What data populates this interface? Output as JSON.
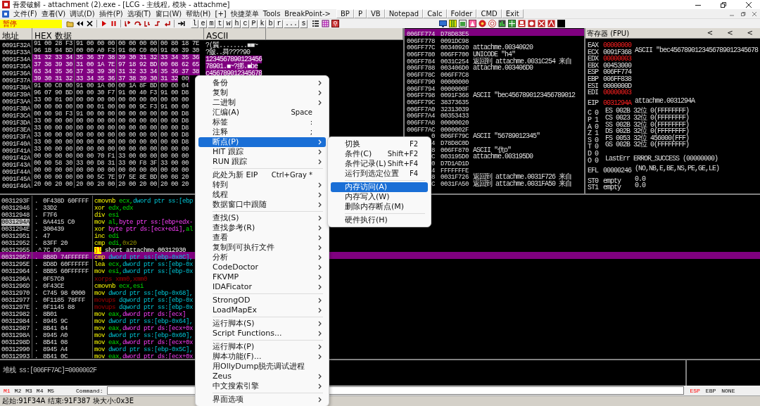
{
  "window": {
    "title": "吾爱破解 - attachment (2).exe - [LCG - 主线程, 模块 - attachme]"
  },
  "menu_bar": {
    "items": [
      "文件(F)",
      "查看(V)",
      "调试(D)",
      "插件(P)",
      "选项(T)",
      "窗口(W)",
      "帮助(H)",
      "[+]",
      "快捷菜单",
      "Tools",
      "BreakPoint->"
    ],
    "buttons": [
      "BP",
      "P",
      "VB",
      "Notepad",
      "Calc",
      "Folder",
      "CMD",
      "Exit"
    ]
  },
  "toolbar": {
    "status": "暂停",
    "letter_buttons": [
      "l",
      "e",
      "m",
      "t",
      "w",
      "h",
      "c",
      "P",
      "k",
      "b",
      "r",
      "...",
      "s"
    ]
  },
  "hex_dump": {
    "columns": [
      "地址",
      "HEX 数据",
      "ASCII"
    ],
    "rows": [
      {
        "address": "0091F32A",
        "groups": [
          {
            "bytes": "91 00 28 F3",
            "selected": false
          },
          {
            "bytes": "91 00 00 00",
            "selected": false
          },
          {
            "bytes": "00 00 00 00",
            "selected": false
          },
          {
            "bytes": "00 80 18 7E",
            "selected": false
          }
        ],
        "ascii": "?(鬤........■■~",
        "ascii_selected": false
      },
      {
        "address": "0091F33A",
        "groups": [
          {
            "bytes": "96 1B 94 BD",
            "selected": false
          },
          {
            "bytes": "00 00 A0 F3",
            "selected": false
          },
          {
            "bytes": "91 00 C0 00",
            "selected": false
          },
          {
            "bytes": "91 00 39 30",
            "selected": false
          }
        ],
        "ascii": "?皼..曻????90",
        "ascii_selected": false
      },
      {
        "address": "0091F34A",
        "groups": [
          {
            "bytes": "31 32 33 34",
            "selected": true
          },
          {
            "bytes": "35 36 37 38",
            "selected": true
          },
          {
            "bytes": "39 30 31 32",
            "selected": true
          },
          {
            "bytes": "33 34 35 36",
            "selected": true
          }
        ],
        "ascii": "1234567890123456",
        "ascii_selected": true
      },
      {
        "address": "0091F35A",
        "groups": [
          {
            "bytes": "37 38 39 30",
            "selected": true
          },
          {
            "bytes": "31 00 1A 7E",
            "selected": true
          },
          {
            "bytes": "97 18 92 BD",
            "selected": true
          },
          {
            "bytes": "00 08 62 65",
            "selected": true
          }
        ],
        "ascii": "78901.■~?挷.■be",
        "ascii_selected": true
      },
      {
        "address": "0091F36A",
        "groups": [
          {
            "bytes": "63 34 35 36",
            "selected": true
          },
          {
            "bytes": "37 38 39 30",
            "selected": true
          },
          {
            "bytes": "31 32 33 34",
            "selected": true
          },
          {
            "bytes": "35 36 37 38",
            "selected": true
          }
        ],
        "ascii": "c456789012345678",
        "ascii_selected": true
      },
      {
        "address": "0091F37A",
        "groups": [
          {
            "bytes": "39 30 31 32",
            "selected": true
          },
          {
            "bytes": "33 34 35 36",
            "selected": true
          },
          {
            "bytes": "37 38 39 30",
            "selected": true
          },
          {
            "bytes": "31 32",
            "selected": true,
            "tail": "00"
          }
        ]
      },
      {
        "address": "0091F38A",
        "groups": [
          {
            "bytes": "91 00 C0 00",
            "selected": false
          },
          {
            "bytes": "91 00 1A 00",
            "selected": false
          },
          {
            "bytes": "00 1A 8F BD",
            "selected": false
          },
          {
            "bytes": "00 00 04",
            "selected": false
          }
        ]
      },
      {
        "address": "0091F39A",
        "groups": [
          {
            "bytes": "96 07 90 BD",
            "selected": false
          },
          {
            "bytes": "00 00 30 F7",
            "selected": false
          },
          {
            "bytes": "91 00 40 F3",
            "selected": false
          },
          {
            "bytes": "91 00 D8",
            "selected": false
          }
        ]
      },
      {
        "address": "0091F3AA",
        "groups": [
          {
            "bytes": "33 00 01 00",
            "selected": false
          },
          {
            "bytes": "00 00 00 00",
            "selected": false
          },
          {
            "bytes": "00 00 00 00",
            "selected": false
          },
          {
            "bytes": "00 00 00",
            "selected": false
          }
        ]
      },
      {
        "address": "0091F3BA",
        "groups": [
          {
            "bytes": "00 00 00 00",
            "selected": false
          },
          {
            "bytes": "00 00 01 00",
            "selected": false
          },
          {
            "bytes": "00 00 9C F3",
            "selected": false
          },
          {
            "bytes": "91 00 00",
            "selected": false
          }
        ]
      },
      {
        "address": "0091F3CA",
        "groups": [
          {
            "bytes": "00 00 98 F3",
            "selected": false
          },
          {
            "bytes": "91 00 00 00",
            "selected": false
          },
          {
            "bytes": "00 00 00 00",
            "selected": false
          },
          {
            "bytes": "00 00 D8",
            "selected": false
          }
        ]
      },
      {
        "address": "0091F3DA",
        "groups": [
          {
            "bytes": "33 00 00 00",
            "selected": false
          },
          {
            "bytes": "00 00 00 00",
            "selected": false
          },
          {
            "bytes": "00 00 00 00",
            "selected": false
          },
          {
            "bytes": "00 00 D8",
            "selected": false
          }
        ]
      },
      {
        "address": "0091F3EA",
        "groups": [
          {
            "bytes": "33 00 00 00",
            "selected": false
          },
          {
            "bytes": "00 00 00 00",
            "selected": false
          },
          {
            "bytes": "00 00 00 00",
            "selected": false
          },
          {
            "bytes": "00 00 D8",
            "selected": false
          }
        ]
      },
      {
        "address": "0091F3FA",
        "groups": [
          {
            "bytes": "33 00 00 00",
            "selected": false
          },
          {
            "bytes": "00 00 00 00",
            "selected": false
          },
          {
            "bytes": "00 00 00 00",
            "selected": false
          },
          {
            "bytes": "00 00 D8",
            "selected": false
          }
        ]
      },
      {
        "address": "0091F40A",
        "groups": [
          {
            "bytes": "33 00 00 00",
            "selected": false
          },
          {
            "bytes": "00 00 00 00",
            "selected": false
          },
          {
            "bytes": "00 00 00 00",
            "selected": false
          },
          {
            "bytes": "00 00 D8",
            "selected": false
          }
        ]
      },
      {
        "address": "0091F41A",
        "groups": [
          {
            "bytes": "33 00 00 00",
            "selected": false
          },
          {
            "bytes": "00 00 00 00",
            "selected": false
          },
          {
            "bytes": "00 00 00 00",
            "selected": false
          },
          {
            "bytes": "00 00 00",
            "selected": false
          }
        ]
      },
      {
        "address": "0091F42A",
        "groups": [
          {
            "bytes": "00 00 00 00",
            "selected": false
          },
          {
            "bytes": "00 00 70 F1",
            "selected": false
          },
          {
            "bytes": "33 00 00 00",
            "selected": false
          },
          {
            "bytes": "00 00 00",
            "selected": false
          }
        ]
      },
      {
        "address": "0091F43A",
        "groups": [
          {
            "bytes": "00 00 58 30",
            "selected": false
          },
          {
            "bytes": "33 00 D8 31",
            "selected": false
          },
          {
            "bytes": "33 00 F8 3F",
            "selected": false
          },
          {
            "bytes": "33 00 00",
            "selected": false
          }
        ]
      },
      {
        "address": "0091F44A",
        "groups": [
          {
            "bytes": "00 00 00 00",
            "selected": false
          },
          {
            "bytes": "00 00 00 00",
            "selected": false
          },
          {
            "bytes": "00 00 00 00",
            "selected": false
          },
          {
            "bytes": "00 00 00",
            "selected": false
          }
        ]
      },
      {
        "address": "0091F45A",
        "groups": [
          {
            "bytes": "00 00 00 00",
            "selected": false
          },
          {
            "bytes": "00 00 5C 7E",
            "selected": false
          },
          {
            "bytes": "97 5E 8E BD",
            "selected": false
          },
          {
            "bytes": "00 08 20",
            "selected": false
          }
        ]
      },
      {
        "address": "0091F46A",
        "groups": [
          {
            "bytes": "20 00 20 00",
            "selected": false
          },
          {
            "bytes": "20 00 20 00",
            "selected": false
          },
          {
            "bytes": "20 00 20 00",
            "selected": false
          },
          {
            "bytes": "20 00 20",
            "selected": false
          }
        ]
      }
    ]
  },
  "stack": {
    "rows": [
      {
        "address": "006FF774",
        "value": "D78D83E5",
        "selected": true
      },
      {
        "address": "006FF778",
        "value": "0091DC98",
        "selected": false
      },
      {
        "address": "006FF77C",
        "value": "00340920",
        "comment": "attachme.00340920",
        "selected": false
      },
      {
        "address": "006FF780",
        "value": "006FF700",
        "comment": "UNICODE \"h4\"",
        "selected": false
      },
      {
        "address": "006FF784",
        "value": "0031C254",
        "comment": "返回到 attachme.0031C254 来自",
        "selected": false
      },
      {
        "address": "006FF788",
        "value": "003406D0",
        "comment": "attachme.003406D0",
        "selected": false
      },
      {
        "address": "006FF78C",
        "value": "006FF7C8",
        "selected": false
      },
      {
        "address": "006FF790",
        "value": "00000000",
        "selected": false
      },
      {
        "address": "006FF794",
        "value": "0000000F",
        "selected": false
      },
      {
        "address": "006FF798",
        "value": "0091F368",
        "comment": "ASCII \"bec4567890123456789012",
        "selected": false
      },
      {
        "address": "006FF79C",
        "value": "38373635",
        "selected": false
      },
      {
        "address": "006FF7A0",
        "value": "32313039",
        "selected": false
      },
      {
        "address": "006FF7A4",
        "value": "00353433",
        "selected": false
      },
      {
        "address": "006FF7A8",
        "value": "00000020",
        "selected": false
      },
      {
        "address": "006FF7AC",
        "value": "0000002F",
        "selected": false
      },
      {
        "address": "0",
        "value": "006FF79C",
        "comment": "ASCII \"56789012345\"",
        "selected": false
      },
      {
        "address": "4",
        "value": "D78D8C0D",
        "selected": false
      },
      {
        "address": "8",
        "value": "006FF870",
        "comment": "ASCII \"伉o\"",
        "selected": false
      },
      {
        "address": "C",
        "value": "003195D0",
        "comment": "attachme.003195D0",
        "selected": false
      },
      {
        "address": "0",
        "value": "D7D1AD1D",
        "selected": false
      },
      {
        "address": "4",
        "value": "FFFFFFFE",
        "selected": false
      },
      {
        "address": "8",
        "value": "0031F726",
        "comment": "返回到 attachme.0031F726 来自",
        "selected": false
      },
      {
        "address": "C",
        "value": "0031FA50",
        "comment": "返回到 attachme.0031FA50 来自",
        "selected": false
      }
    ]
  },
  "registers": {
    "title": "寄存器 (FPU)",
    "buttons": [
      "<",
      "<",
      "<"
    ],
    "lines": [
      {
        "kind": "reg",
        "name": "EAX",
        "value": "00000000",
        "changed": true
      },
      {
        "kind": "reg",
        "name": "ECX",
        "value": "0091F368",
        "changed": false,
        "comment": "ASCII \"bec4567890123456789012345678"
      },
      {
        "kind": "reg",
        "name": "EDX",
        "value": "00000003",
        "changed": true
      },
      {
        "kind": "reg",
        "name": "EBX",
        "value": "00453000",
        "changed": false
      },
      {
        "kind": "reg",
        "name": "ESP",
        "value": "006FF774",
        "changed": false
      },
      {
        "kind": "reg",
        "name": "EBP",
        "value": "006FF838",
        "changed": false
      },
      {
        "kind": "reg",
        "name": "ESI",
        "value": "0000000D",
        "changed": false
      },
      {
        "kind": "reg",
        "name": "EDI",
        "value": "00000003",
        "changed": true
      },
      {
        "kind": "gap"
      },
      {
        "kind": "reg",
        "name": "EIP",
        "value": "0031294A",
        "changed": true,
        "comment": "attachme.0031294A"
      },
      {
        "kind": "gap"
      },
      {
        "kind": "flag",
        "flag": "C",
        "bit": "0",
        "detail": "ES 002B 32位 0(FFFFFFFF)"
      },
      {
        "kind": "flag",
        "flag": "P",
        "bit": "1",
        "detail": "CS 0023 32位 0(FFFFFFFF)"
      },
      {
        "kind": "flag",
        "flag": "A",
        "bit": "0",
        "detail": "SS 002B 32位 0(FFFFFFFF)"
      },
      {
        "kind": "flag",
        "flag": "Z",
        "bit": "1",
        "detail": "DS 002B 32位 0(FFFFFFFF)"
      },
      {
        "kind": "flag",
        "flag": "S",
        "bit": "0",
        "detail": "FS 0053 32位 456000(FFF)"
      },
      {
        "kind": "flag",
        "flag": "T",
        "bit": "0",
        "detail": "GS 002B 32位 0(FFFFFFFF)"
      },
      {
        "kind": "flag",
        "flag": "D",
        "bit": "0"
      },
      {
        "kind": "flag",
        "flag": "O",
        "bit": "0",
        "detail": "LastErr ERROR_SUCCESS (00000000)"
      },
      {
        "kind": "gap"
      },
      {
        "kind": "reg",
        "name": "EFL",
        "value": "00000246",
        "changed": false,
        "comment": "(NO,NB,E,BE,NS,PE,GE,LE)"
      },
      {
        "kind": "gap"
      },
      {
        "kind": "reg",
        "name": "ST0",
        "value": "empty",
        "changed": false,
        "comment": "0.0"
      },
      {
        "kind": "reg",
        "name": "ST1",
        "value": "empty",
        "changed": false,
        "comment": "0.0"
      }
    ]
  },
  "disassembly": {
    "rows": [
      {
        "address": "0031293F",
        "marker": ".",
        "hex": "0F438D 60FFFF",
        "mnemonic": {
          "text": "cmovnb",
          "kind": "op"
        },
        "operands": [
          {
            "text": "ecx,",
            "kind": "reg"
          },
          {
            "text": "dword ptr ss:[ebp",
            "kind": "stack"
          }
        ],
        "selected": false,
        "current": false
      },
      {
        "address": "00312946",
        "marker": ".",
        "hex": "33D2",
        "mnemonic": {
          "text": "xor",
          "kind": "op"
        },
        "operands": [
          {
            "text": "edx,edx",
            "kind": "reg"
          }
        ],
        "selected": false,
        "current": false
      },
      {
        "address": "00312948",
        "marker": ".",
        "hex": "F7F6",
        "mnemonic": {
          "text": "div",
          "kind": "op"
        },
        "operands": [
          {
            "text": "esi",
            "kind": "reg"
          }
        ],
        "selected": false,
        "current": false
      },
      {
        "address": "0031294A",
        "marker": ".",
        "hex": "8A4415 C0",
        "mnemonic": {
          "text": "mov",
          "kind": "op"
        },
        "operands": [
          {
            "text": "al,",
            "kind": "reg"
          },
          {
            "text": "byte ptr ss:[ebp+edx-",
            "kind": "mem"
          }
        ],
        "selected": false,
        "current": true
      },
      {
        "address": "0031294E",
        "marker": ".",
        "hex": "300439",
        "mnemonic": {
          "text": "xor",
          "kind": "op"
        },
        "operands": [
          {
            "text": "byte ptr ds:[ecx+edi],",
            "kind": "mem"
          },
          {
            "text": "al",
            "kind": "reg"
          }
        ],
        "selected": false,
        "current": false
      },
      {
        "address": "00312951",
        "marker": ".",
        "hex": "47",
        "mnemonic": {
          "text": "inc",
          "kind": "op"
        },
        "operands": [
          {
            "text": "edi",
            "kind": "reg"
          }
        ],
        "selected": false,
        "current": false
      },
      {
        "address": "00312952",
        "marker": ".",
        "hex": "83FF 20",
        "mnemonic": {
          "text": "cmp",
          "kind": "op"
        },
        "operands": [
          {
            "text": "edi,",
            "kind": "reg"
          },
          {
            "text": "0x20",
            "kind": "num"
          }
        ],
        "selected": false,
        "current": false
      },
      {
        "address": "00312955",
        "marker": ".^",
        "hex": "7C D9",
        "mnemonic": {
          "text": "jl",
          "kind": "jcc"
        },
        "operands": [
          {
            "text": "short attachme.00312930",
            "kind": "plain"
          }
        ],
        "selected": false,
        "current": false
      },
      {
        "address": "00312957",
        "marker": ".",
        "hex": "8B8D 74FFFFFF",
        "mnemonic": {
          "text": "cmp",
          "kind": "op"
        },
        "operands": [
          {
            "text": "dword ptr ss:[ebp-0x8C],",
            "kind": "stack"
          }
        ],
        "selected": true,
        "current": false
      },
      {
        "address": "0031295E",
        "marker": ".",
        "hex": "8D8D 60FFFFFF",
        "mnemonic": {
          "text": "lea",
          "kind": "op"
        },
        "operands": [
          {
            "text": "ecx,",
            "kind": "reg"
          },
          {
            "text": "dword ptr ss:[ebp-0x",
            "kind": "stack"
          }
        ],
        "selected": false,
        "current": false
      },
      {
        "address": "00312964",
        "marker": ".",
        "hex": "8BB5 60FFFFFF",
        "mnemonic": {
          "text": "mov",
          "kind": "op"
        },
        "operands": [
          {
            "text": "esi,",
            "kind": "reg"
          },
          {
            "text": "dword ptr ss:[ebp-0x",
            "kind": "stack"
          }
        ],
        "selected": false,
        "current": false
      },
      {
        "address": "0031296A",
        "marker": ".",
        "hex": "0F57C0",
        "mnemonic": {
          "text": "xorps",
          "kind": "sse"
        },
        "operands": [
          {
            "text": "xmm0,xmm0",
            "kind": "sse"
          }
        ],
        "selected": false,
        "current": false
      },
      {
        "address": "0031296D",
        "marker": ".",
        "hex": "0F43CE",
        "mnemonic": {
          "text": "cmovnb",
          "kind": "op"
        },
        "operands": [
          {
            "text": "ecx,esi",
            "kind": "reg"
          }
        ],
        "selected": false,
        "current": false
      },
      {
        "address": "00312970",
        "marker": ".",
        "hex": "C745 98 0000",
        "mnemonic": {
          "text": "mov",
          "kind": "op"
        },
        "operands": [
          {
            "text": "dword ptr ss:[ebp-0x68],",
            "kind": "stack"
          }
        ],
        "selected": false,
        "current": false
      },
      {
        "address": "00312977",
        "marker": ".",
        "hex": "0F1185 78FFF",
        "mnemonic": {
          "text": "movups",
          "kind": "sse"
        },
        "operands": [
          {
            "text": "dqword ptr ss:[ebp-0x",
            "kind": "stack"
          }
        ],
        "selected": false,
        "current": false
      },
      {
        "address": "0031297E",
        "marker": ".",
        "hex": "0F1145 88",
        "mnemonic": {
          "text": "movups",
          "kind": "sse"
        },
        "operands": [
          {
            "text": "dqword ptr ss:[ebp-0x",
            "kind": "stack"
          }
        ],
        "selected": false,
        "current": false
      },
      {
        "address": "00312982",
        "marker": ".",
        "hex": "8B01",
        "mnemonic": {
          "text": "mov",
          "kind": "op"
        },
        "operands": [
          {
            "text": "eax,",
            "kind": "reg"
          },
          {
            "text": "dword ptr ds:[ecx]",
            "kind": "mem"
          }
        ],
        "selected": false,
        "current": false
      },
      {
        "address": "00312984",
        "marker": ".",
        "hex": "8945 9C",
        "mnemonic": {
          "text": "mov",
          "kind": "op"
        },
        "operands": [
          {
            "text": "dword ptr ss:[ebp-0x64],",
            "kind": "stack"
          }
        ],
        "selected": false,
        "current": false
      },
      {
        "address": "00312987",
        "marker": ".",
        "hex": "8B41 04",
        "mnemonic": {
          "text": "mov",
          "kind": "op"
        },
        "operands": [
          {
            "text": "eax,",
            "kind": "reg"
          },
          {
            "text": "dword ptr ds:[ecx+0x",
            "kind": "mem"
          }
        ],
        "selected": false,
        "current": false
      },
      {
        "address": "0031298A",
        "marker": ".",
        "hex": "8945 A0",
        "mnemonic": {
          "text": "mov",
          "kind": "op"
        },
        "operands": [
          {
            "text": "dword ptr ss:[ebp-0x60],",
            "kind": "stack"
          }
        ],
        "selected": false,
        "current": false
      },
      {
        "address": "0031298D",
        "marker": ".",
        "hex": "8B41 08",
        "mnemonic": {
          "text": "mov",
          "kind": "op"
        },
        "operands": [
          {
            "text": "eax,",
            "kind": "reg"
          },
          {
            "text": "dword ptr ds:[ecx+0x",
            "kind": "mem"
          }
        ],
        "selected": false,
        "current": false
      },
      {
        "address": "00312990",
        "marker": ".",
        "hex": "8945 A4",
        "mnemonic": {
          "text": "mov",
          "kind": "op"
        },
        "operands": [
          {
            "text": "dword ptr ss:[ebp-0x5C],",
            "kind": "stack"
          }
        ],
        "selected": false,
        "current": false
      },
      {
        "address": "00312993",
        "marker": ".",
        "hex": "8B41 0C",
        "mnemonic": {
          "text": "mov",
          "kind": "op"
        },
        "operands": [
          {
            "text": "eax,",
            "kind": "reg"
          },
          {
            "text": "dword ptr ds:[ecx+0x",
            "kind": "mem"
          }
        ],
        "selected": false,
        "current": false
      }
    ]
  },
  "info": {
    "text": "堆栈 ss:[006FF7AC]=0000002F"
  },
  "command_bar": {
    "marks": [
      {
        "label": "M1",
        "selected": true
      },
      {
        "label": "M2",
        "selected": false
      },
      {
        "label": "M3",
        "selected": false
      },
      {
        "label": "M4",
        "selected": false
      },
      {
        "label": "M5",
        "selected": false
      }
    ],
    "label": "Command:",
    "registers": [
      {
        "label": "ESP",
        "selected": true
      },
      {
        "label": "EBP",
        "selected": false
      },
      {
        "label": "NONE",
        "selected": false
      }
    ]
  },
  "status_bar": {
    "text": "起始:91F34A 结束:91F387 块大小:0x3E"
  },
  "context_menu": {
    "items": [
      {
        "kind": "item",
        "label": "备份",
        "submenu": true,
        "selected": false
      },
      {
        "kind": "item",
        "label": "复制",
        "submenu": true,
        "selected": false
      },
      {
        "kind": "item",
        "label": "二进制",
        "submenu": true,
        "selected": false
      },
      {
        "kind": "item",
        "label": "汇编(A)",
        "shortcut": "Space",
        "submenu": false,
        "selected": false
      },
      {
        "kind": "item",
        "label": "标签",
        "shortcut": ":",
        "submenu": false,
        "selected": false
      },
      {
        "kind": "item",
        "label": "注释",
        "shortcut": ";",
        "submenu": false,
        "selected": false
      },
      {
        "kind": "item",
        "label": "断点(P)",
        "submenu": true,
        "selected": true
      },
      {
        "kind": "item",
        "label": "HIT 跟踪",
        "submenu": true,
        "selected": false
      },
      {
        "kind": "item",
        "label": "RUN 跟踪",
        "submenu": true,
        "selected": false
      },
      {
        "kind": "separator"
      },
      {
        "kind": "item",
        "label": "此处为新 EIP",
        "shortcut": "Ctrl+Gray *",
        "submenu": false,
        "selected": false
      },
      {
        "kind": "item",
        "label": "转到",
        "submenu": true,
        "selected": false
      },
      {
        "kind": "item",
        "label": "线程",
        "submenu": true,
        "selected": false
      },
      {
        "kind": "item",
        "label": "数据窗口中跟随",
        "submenu": true,
        "selected": false
      },
      {
        "kind": "separator"
      },
      {
        "kind": "item",
        "label": "查找(S)",
        "submenu": true,
        "selected": false
      },
      {
        "kind": "item",
        "label": "查找参考(R)",
        "submenu": true,
        "selected": false
      },
      {
        "kind": "item",
        "label": "查看",
        "submenu": true,
        "selected": false
      },
      {
        "kind": "item",
        "label": "复制到可执行文件",
        "submenu": true,
        "selected": false
      },
      {
        "kind": "item",
        "label": "分析",
        "submenu": true,
        "selected": false
      },
      {
        "kind": "item",
        "label": "CodeDoctor",
        "submenu": true,
        "selected": false
      },
      {
        "kind": "item",
        "label": "FKVMP",
        "submenu": true,
        "selected": false
      },
      {
        "kind": "item",
        "label": "IDAFicator",
        "submenu": true,
        "selected": false
      },
      {
        "kind": "separator"
      },
      {
        "kind": "item",
        "label": "StrongOD",
        "submenu": true,
        "selected": false
      },
      {
        "kind": "item",
        "label": "LoadMapEx",
        "submenu": true,
        "selected": false
      },
      {
        "kind": "separator"
      },
      {
        "kind": "item",
        "label": "运行脚本(S)",
        "submenu": true,
        "selected": false
      },
      {
        "kind": "item",
        "label": "Script Functions...",
        "submenu": true,
        "selected": false
      },
      {
        "kind": "separator"
      },
      {
        "kind": "item",
        "label": "运行脚本(P)",
        "submenu": true,
        "selected": false
      },
      {
        "kind": "item",
        "label": "脚本功能(F)...",
        "submenu": true,
        "selected": false
      },
      {
        "kind": "item",
        "label": "用OllyDump脱壳调试进程",
        "submenu": false,
        "selected": false
      },
      {
        "kind": "item",
        "label": "Zeus",
        "submenu": true,
        "selected": false
      },
      {
        "kind": "item",
        "label": "中文搜索引擎",
        "submenu": true,
        "selected": false
      },
      {
        "kind": "separator"
      },
      {
        "kind": "item",
        "label": "界面选项",
        "submenu": true,
        "selected": false
      }
    ]
  },
  "submenu": {
    "items": [
      {
        "kind": "item",
        "label": "切换",
        "shortcut": "F2",
        "selected": false
      },
      {
        "kind": "item",
        "label": "条件(C)",
        "shortcut": "Shift+F2",
        "selected": false
      },
      {
        "kind": "item",
        "label": "条件记录(L)",
        "shortcut": "Shift+F4",
        "selected": false
      },
      {
        "kind": "item",
        "label": "运行到选定位置",
        "shortcut": "F4",
        "selected": false
      },
      {
        "kind": "separator"
      },
      {
        "kind": "item",
        "label": "内存访问(A)",
        "selected": true
      },
      {
        "kind": "item",
        "label": "内存写入(W)",
        "selected": false
      },
      {
        "kind": "item",
        "label": "删除内存断点(M)",
        "selected": false
      },
      {
        "kind": "separator"
      },
      {
        "kind": "item",
        "label": "硬件执行(H)",
        "selected": false
      }
    ]
  }
}
